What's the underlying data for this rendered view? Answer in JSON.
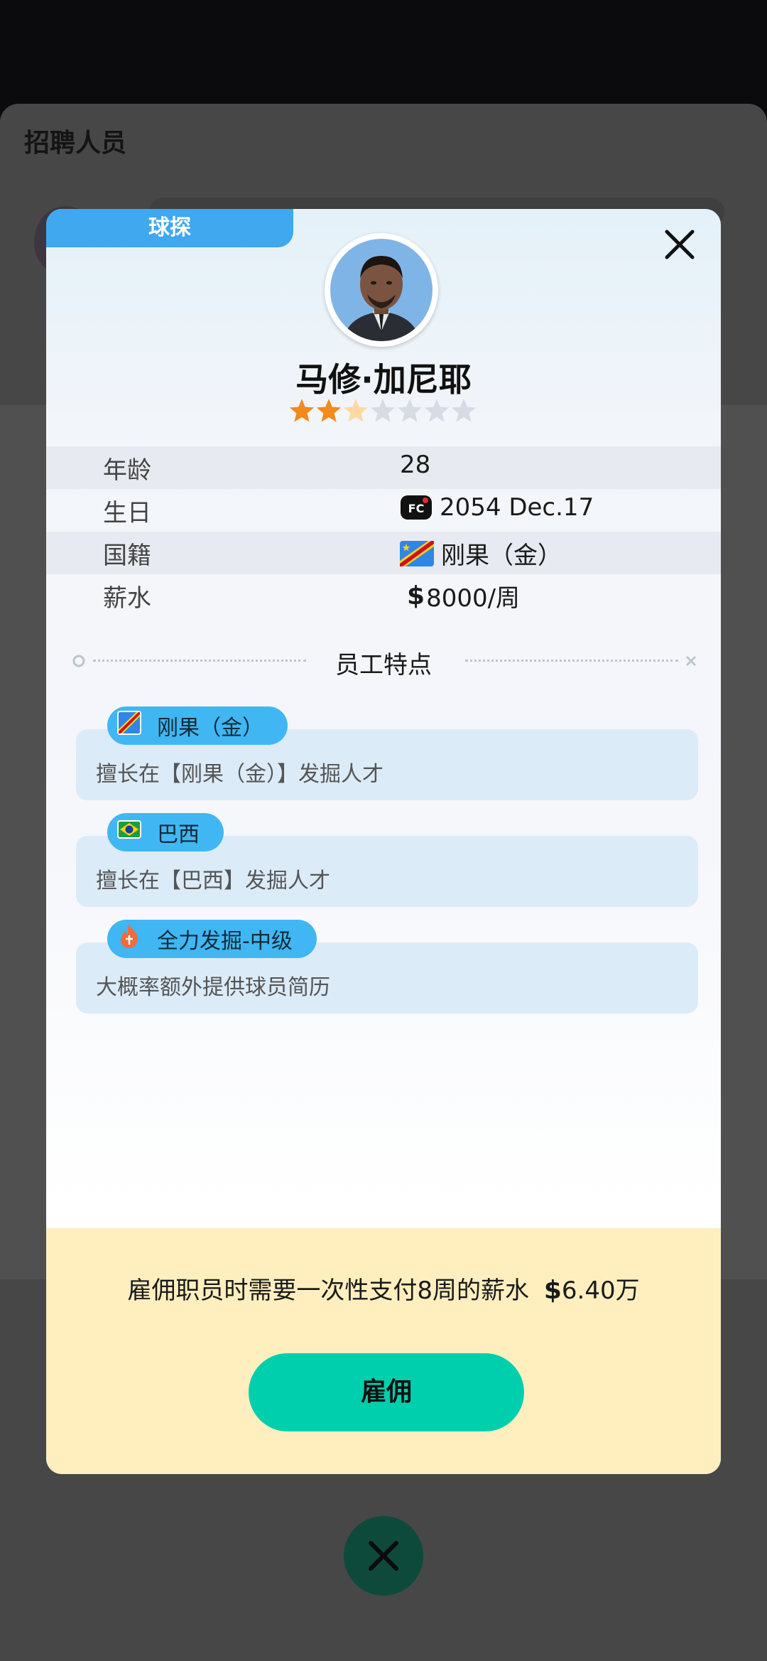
{
  "background": {
    "title": "招聘人员"
  },
  "modal": {
    "tag": "球探",
    "name": "马修·加尼耶",
    "rating": {
      "filled": 2,
      "half": 1,
      "total": 7
    },
    "info": [
      {
        "label": "年龄",
        "value": "28"
      },
      {
        "label": "生日",
        "value": "2054 Dec.17"
      },
      {
        "label": "国籍",
        "value": "刚果（金）"
      },
      {
        "label": "薪水",
        "currency": "$",
        "value": "8000/周"
      }
    ],
    "section_title": "员工特点",
    "traits": [
      {
        "icon": "congo-flag-icon",
        "title": "刚果（金）",
        "desc": "擅长在【刚果（金）】发掘人才"
      },
      {
        "icon": "brazil-flag-icon",
        "title": "巴西",
        "desc": "擅长在【巴西】发掘人才"
      },
      {
        "icon": "fire-icon",
        "title": "全力发掘-中级",
        "desc": "大概率额外提供球员简历"
      }
    ],
    "footer": {
      "text": "雇佣职员时需要一次性支付8周的薪水",
      "currency": "$",
      "amount": "6.40万",
      "button": "雇佣"
    }
  },
  "colors": {
    "tag": "#3fa8ee",
    "star": "#f28a1c",
    "hire_button": "#00cfae",
    "footer_bg": "#ffefbf"
  }
}
